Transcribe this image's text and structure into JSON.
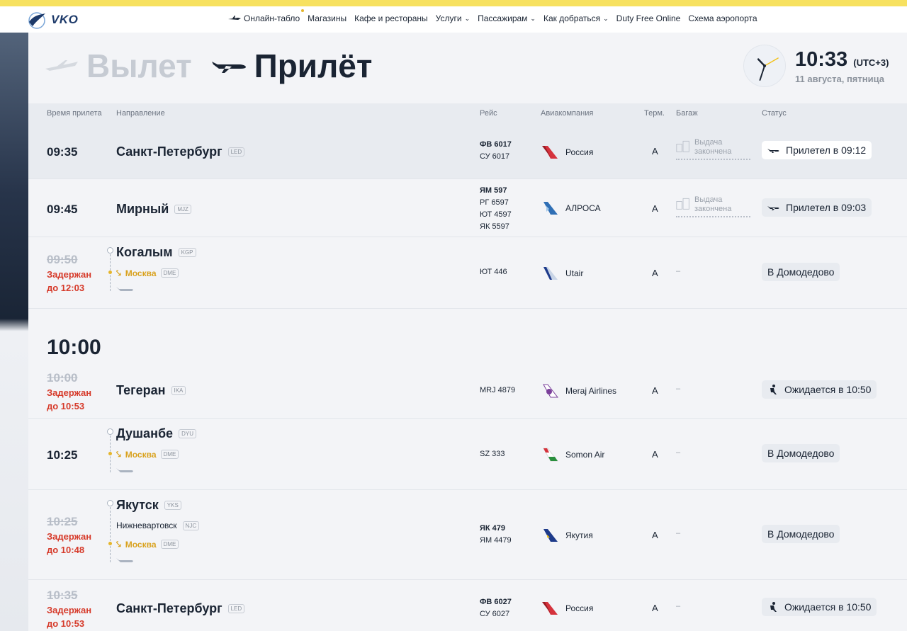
{
  "header": {
    "logo_text": "VKO",
    "nav": [
      {
        "label": "Онлайн-табло",
        "icon": "plane-icon",
        "dropdown": false
      },
      {
        "label": "Магазины",
        "dropdown": false
      },
      {
        "label": "Кафе и рестораны",
        "dropdown": false
      },
      {
        "label": "Услуги",
        "dropdown": true
      },
      {
        "label": "Пассажирам",
        "dropdown": true
      },
      {
        "label": "Как добраться",
        "dropdown": true
      },
      {
        "label": "Duty Free Online",
        "dropdown": false
      },
      {
        "label": "Схема аэропорта",
        "dropdown": false
      }
    ]
  },
  "board": {
    "tab_departure": "Вылет",
    "tab_arrival": "Прилёт",
    "active_tab": "arrival",
    "time": "10:33",
    "timezone": "(UTC+3)",
    "date": "11 августа, пятница",
    "clock": {
      "hours": 10,
      "minutes": 33,
      "seconds": 10
    }
  },
  "columns": {
    "time": "Время прилета",
    "direction": "Направление",
    "flight": "Рейс",
    "airline": "Авиакомпания",
    "terminal": "Терм.",
    "baggage": "Багаж",
    "status": "Статус"
  },
  "hour_label": "10:00",
  "colors": {
    "accent": "#f7e160",
    "delay": "#d63a2a",
    "transfer": "#d9a21f",
    "text": "#1a2433"
  },
  "flights": [
    {
      "time": "09:35",
      "city": "Санкт-Петербург",
      "iata": "LED",
      "numbers": [
        "ФВ 6017",
        "СУ 6017"
      ],
      "airline": "Россия",
      "terminal": "A",
      "baggage": "Выдача закончена",
      "status": "Прилетел в 09:12"
    },
    {
      "time": "09:45",
      "city": "Мирный",
      "iata": "MJZ",
      "numbers": [
        "ЯМ 597",
        "РГ 6597",
        "ЮТ 4597",
        "ЯК 5597"
      ],
      "airline": "АЛРОСА",
      "terminal": "A",
      "baggage": "Выдача закончена",
      "status": "Прилетел в 09:03"
    },
    {
      "time_old": "09:50",
      "delay_1": "Задержан",
      "delay_2": "до 12:03",
      "city": "Когалым",
      "iata": "KGP",
      "transfer": "Москва",
      "transfer_iata": "DME",
      "numbers": [
        "ЮТ 446"
      ],
      "airline": "Utair",
      "terminal": "A",
      "baggage": "–",
      "status": "В Домодедово"
    },
    {
      "time_old": "10:00",
      "delay_1": "Задержан",
      "delay_2": "до 10:53",
      "city": "Тегеран",
      "iata": "IKA",
      "numbers": [
        "MRJ 4879"
      ],
      "airline": "Meraj Airlines",
      "terminal": "A",
      "baggage": "–",
      "status": "Ожидается в 10:50"
    },
    {
      "time": "10:25",
      "city": "Душанбе",
      "iata": "DYU",
      "transfer": "Москва",
      "transfer_iata": "DME",
      "numbers": [
        "SZ 333"
      ],
      "airline": "Somon Air",
      "terminal": "A",
      "baggage": "–",
      "status": "В Домодедово"
    },
    {
      "time_old": "10:25",
      "delay_1": "Задержан",
      "delay_2": "до 10:48",
      "city": "Якутск",
      "iata": "YKS",
      "via": "Нижневартовск",
      "via_iata": "NJC",
      "transfer": "Москва",
      "transfer_iata": "DME",
      "numbers": [
        "ЯК 479",
        "ЯМ 4479"
      ],
      "airline": "Якутия",
      "terminal": "A",
      "baggage": "–",
      "status": "В Домодедово"
    },
    {
      "time_old": "10:35",
      "delay_1": "Задержан",
      "delay_2": "до 10:53",
      "city": "Санкт-Петербург",
      "iata": "LED",
      "numbers": [
        "ФВ 6027",
        "СУ 6027"
      ],
      "airline": "Россия",
      "terminal": "A",
      "baggage": "–",
      "status": "Ожидается в 10:50"
    }
  ]
}
